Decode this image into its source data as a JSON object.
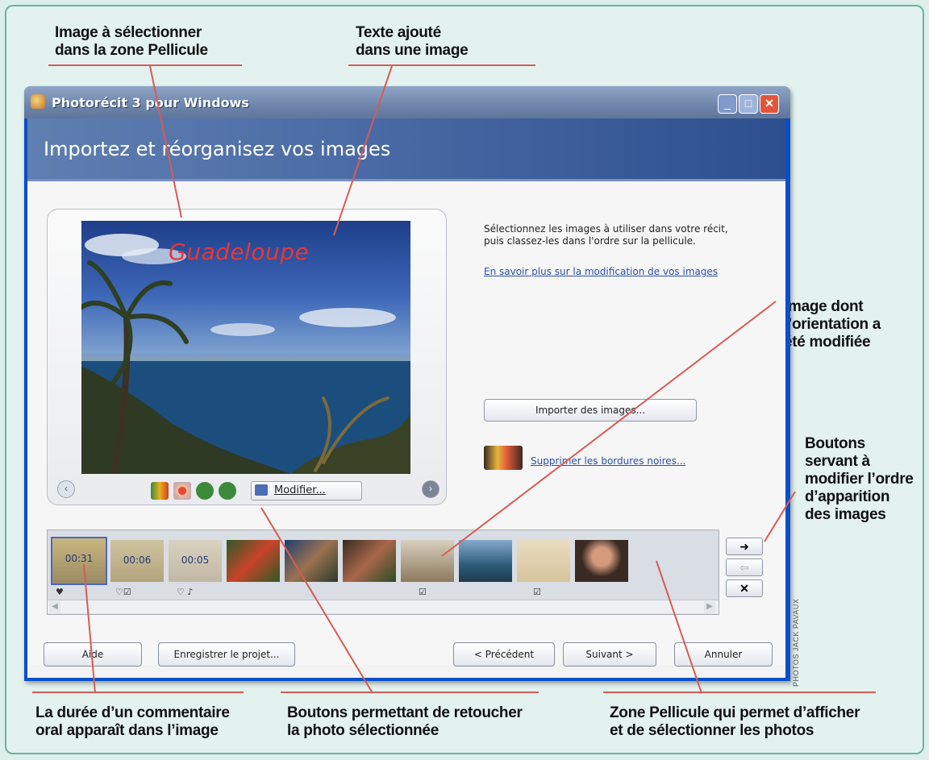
{
  "callouts": {
    "top_left": [
      "Image à sélectionner",
      "dans la zone Pellicule"
    ],
    "top_center": [
      "Texte ajouté",
      "dans une image"
    ],
    "right_orientation": [
      "Image dont",
      "l’orientation a",
      "été modifiée"
    ],
    "right_buttons": [
      "Boutons",
      "servant à",
      "modifier l’ordre",
      "d’apparition",
      "des images"
    ],
    "bottom_left": [
      "La durée d’un commentaire",
      "oral apparaît dans l’image"
    ],
    "bottom_center": [
      "Boutons permettant de retoucher",
      "la photo sélectionnée"
    ],
    "bottom_right": [
      "Zone Pellicule qui permet d’afficher",
      "et de sélectionner les photos"
    ]
  },
  "window": {
    "title": "Photorécit 3 pour Windows",
    "header": "Importez et réorganisez vos images",
    "controls": {
      "minimize": "_",
      "maximize": "□",
      "close": "✕"
    }
  },
  "preview": {
    "caption": "Guadeloupe",
    "prev_icon": "‹",
    "next_icon": "›",
    "modify_label": "Modifier..."
  },
  "instructions": {
    "text": "Sélectionnez les images à utiliser dans votre récit, puis classez-les dans l'ordre sur la pellicule.",
    "link": "En savoir plus sur la modification de vos images",
    "import_button": "Importer des images...",
    "borders_link": "Supprimer les bordures noires..."
  },
  "filmstrip": {
    "items": [
      {
        "duration": "00:31",
        "marks": "♥"
      },
      {
        "duration": "00:06",
        "marks": "♡☑"
      },
      {
        "duration": "00:05",
        "marks": "♡   ♪"
      },
      {
        "duration": "",
        "marks": ""
      },
      {
        "duration": "",
        "marks": ""
      },
      {
        "duration": "",
        "marks": ""
      },
      {
        "duration": "",
        "marks": "☑"
      },
      {
        "duration": "",
        "marks": ""
      },
      {
        "duration": "",
        "marks": "☑"
      },
      {
        "duration": "",
        "marks": ""
      }
    ]
  },
  "order_buttons": {
    "right": "➜",
    "left": "⇦",
    "remove": "✕"
  },
  "bottom_buttons": {
    "help": "Aide",
    "save": "Enregistrer le projet...",
    "previous": "< Précédent",
    "next": "Suivant >",
    "cancel": "Annuler"
  },
  "credit": "PHOTOS JACK PAVAUX",
  "colors": {
    "accent_red": "#d85b55",
    "window_blue": "#0a4fc8",
    "caption_red": "#e83636"
  }
}
